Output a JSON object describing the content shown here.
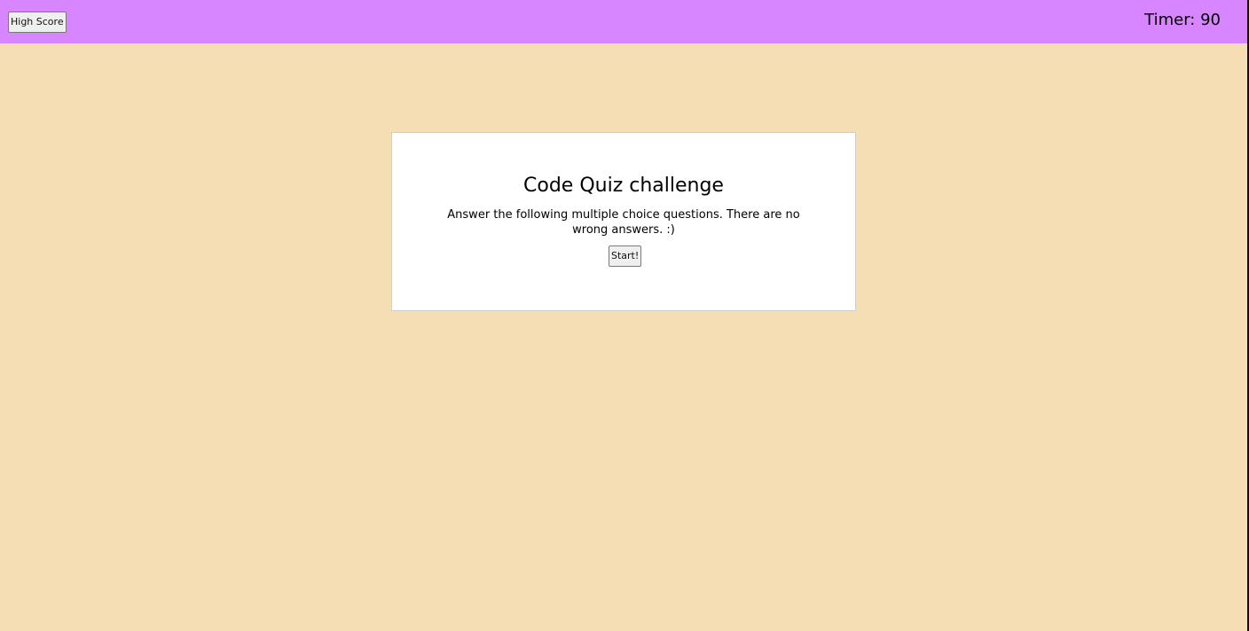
{
  "header": {
    "high_score_label": "High Score",
    "timer_text": "Timer: 90"
  },
  "quiz": {
    "title": "Code Quiz challenge",
    "description": "Answer the following multiple choice questions. There are no wrong answers. :)",
    "start_label": "Start!"
  },
  "colors": {
    "header_background": "#d786ff",
    "page_background": "#f5deb3",
    "card_background": "#ffffff"
  }
}
